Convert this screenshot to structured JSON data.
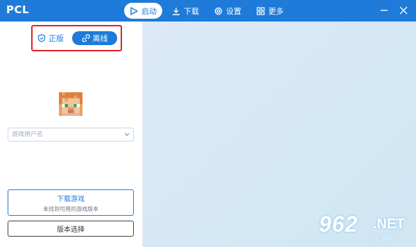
{
  "app": {
    "title": "PCL"
  },
  "nav": {
    "items": [
      {
        "label": "启动",
        "icon": "play-icon",
        "active": true
      },
      {
        "label": "下载",
        "icon": "download-icon",
        "active": false
      },
      {
        "label": "设置",
        "icon": "gear-icon",
        "active": false
      },
      {
        "label": "更多",
        "icon": "grid-icon",
        "active": false
      }
    ]
  },
  "window_controls": {
    "minimize_icon": "minimize-icon",
    "close_icon": "close-icon"
  },
  "login": {
    "modes": [
      {
        "label": "正版",
        "icon": "shield-icon",
        "selected": false
      },
      {
        "label": "离线",
        "icon": "link-broken-icon",
        "selected": true
      }
    ],
    "avatar_icon": "steve-head-avatar",
    "username_placeholder": "游戏用户名",
    "username_value": ""
  },
  "actions": {
    "download_label": "下载游戏",
    "download_sublabel": "未找到可用的游戏版本",
    "version_label": "版本选择"
  },
  "watermark": {
    "number": "962",
    "net": ".NET",
    "sub": "乐游网"
  },
  "colors": {
    "accent": "#1e7bd9",
    "highlight": "#e02020",
    "background_right": "#d6e8f5"
  }
}
